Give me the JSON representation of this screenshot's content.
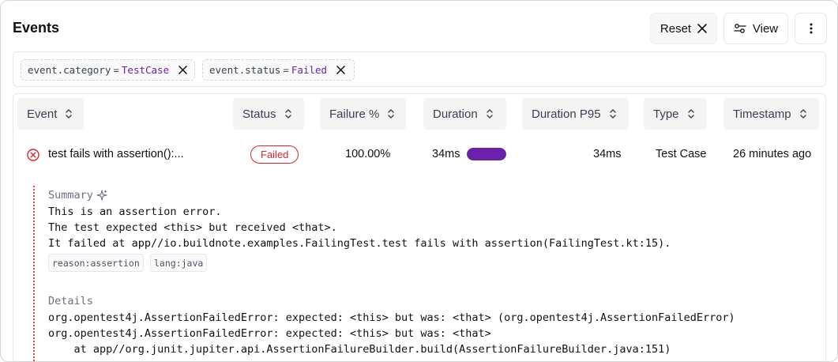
{
  "header": {
    "title": "Events",
    "reset_label": "Reset",
    "view_label": "View"
  },
  "filters": [
    {
      "key": "event.category",
      "op": "=",
      "value": "TestCase"
    },
    {
      "key": "event.status",
      "op": "=",
      "value": "Failed"
    }
  ],
  "table": {
    "columns": [
      "Event",
      "Status",
      "Failure %",
      "Duration",
      "Duration P95",
      "Type",
      "Timestamp"
    ],
    "rows": [
      {
        "event": "test fails with assertion():...",
        "status": "Failed",
        "failure_pct": "100.00%",
        "duration": "34ms",
        "duration_bar_fraction": 1.0,
        "duration_p95": "34ms",
        "type": "Test Case",
        "timestamp": "26 minutes ago"
      }
    ]
  },
  "details": {
    "summary_label": "Summary",
    "summary_lines": [
      "This is an assertion error.",
      "The test expected <this> but received <that>.",
      "It failed at app//io.buildnote.examples.FailingTest.test fails with assertion(FailingTest.kt:15)."
    ],
    "tags": [
      "reason:assertion",
      "lang:java"
    ],
    "details_label": "Details",
    "details_lines": [
      "org.opentest4j.AssertionFailedError: expected: <this> but was: <that> (org.opentest4j.AssertionFailedError)",
      "org.opentest4j.AssertionFailedError: expected: <this> but was: <that>",
      "    at app//org.junit.jupiter.api.AssertionFailureBuilder.build(AssertionFailureBuilder.java:151)"
    ]
  },
  "colors": {
    "accent": "#6b21a8",
    "error": "#dc2626"
  },
  "icons": {
    "error": "x-circle-icon",
    "sort": "chevron-up-down-icon",
    "sparkle": "sparkle-icon",
    "view": "sliders-icon",
    "more": "kebab-icon",
    "close": "close-icon"
  }
}
